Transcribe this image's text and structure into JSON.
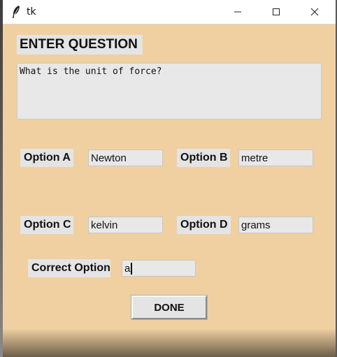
{
  "window": {
    "title": "tk",
    "icon": "feather-icon",
    "controls": [
      "minimize-icon",
      "maximize-icon",
      "close-icon"
    ]
  },
  "form": {
    "heading": "ENTER QUESTION",
    "question": "What is the unit of force?",
    "options": {
      "a": {
        "label": "Option A",
        "value": "Newton"
      },
      "b": {
        "label": "Option B",
        "value": "metre"
      },
      "c": {
        "label": "Option C",
        "value": "kelvin"
      },
      "d": {
        "label": "Option D",
        "value": "grams"
      }
    },
    "correct": {
      "label": "Correct Option",
      "value": "a"
    },
    "done_label": "DONE"
  },
  "colors": {
    "background": "#f0d0a0",
    "field": "#e8e8e8",
    "label_bg": "#e4e4e4"
  }
}
